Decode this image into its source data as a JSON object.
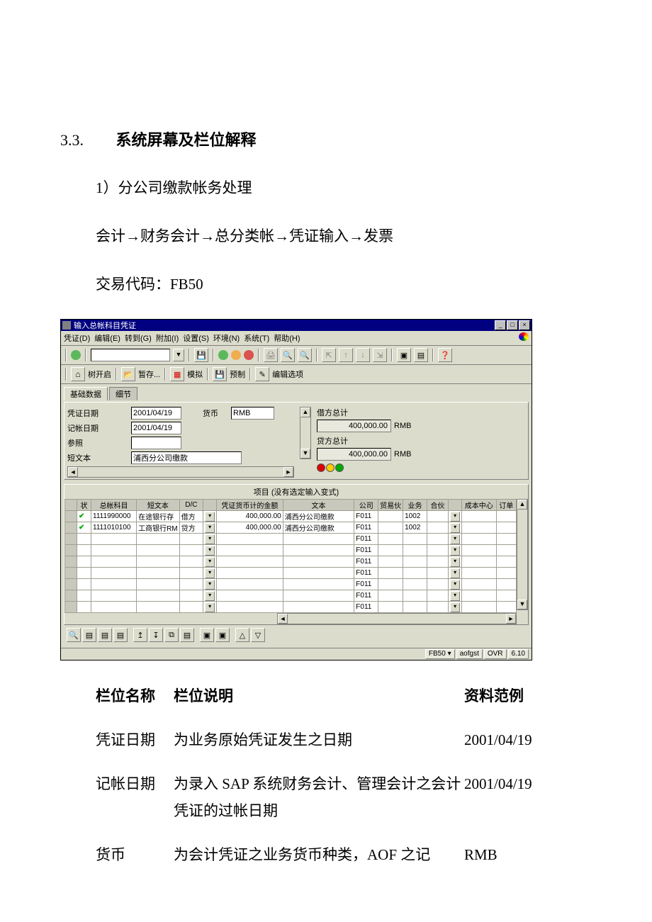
{
  "doc": {
    "section_num": "3.3.",
    "section_title": "系统屏幕及栏位解释",
    "p1": "1）分公司缴款帐务处理",
    "p2": "会计→财务会计→总分类帐→凭证输入→发票",
    "p3": "交易代码：FB50"
  },
  "sap": {
    "titlebar": "输入总帐科目凭证",
    "winbtns": {
      "min": "_",
      "max": "□",
      "close": "×"
    },
    "menu": {
      "m1": "凭证(D)",
      "m2": "编辑(E)",
      "m3": "转到(G)",
      "m4": "附加(I)",
      "m5": "设置(S)",
      "m6": "环境(N)",
      "m7": "系统(T)",
      "m8": "帮助(H)"
    },
    "tb2": {
      "tree": "树开启",
      "park": "暂存...",
      "simulate": "模拟",
      "preset": "预制",
      "editopt": "编辑选项"
    },
    "tabs": {
      "basic": "基础数据",
      "detail": "细节"
    },
    "header": {
      "docdate_label": "凭证日期",
      "docdate": "2001/04/19",
      "currency_label": "货币",
      "currency": "RMB",
      "postdate_label": "记帐日期",
      "postdate": "2001/04/19",
      "ref_label": "参照",
      "shorttxt_label": "短文本",
      "shorttxt": "浦西分公司缴款",
      "debit_label": "借方总计",
      "credit_label": "贷方总计",
      "total_amount": "400,000.00",
      "total_curr": "RMB"
    },
    "items": {
      "title": "项目  (没有选定输入变式)",
      "cols": {
        "status": "状",
        "glacct": "总帐科目",
        "shorttxt": "短文本",
        "dc": "D/C",
        "amount": "凭证货币计的金额",
        "text": "文本",
        "company": "公司",
        "partner1": "贸易伙",
        "ba": "业务",
        "partner2": "合伙",
        "cc": "成本中心",
        "order": "订单"
      },
      "rows": [
        {
          "ok": true,
          "gl": "1111990000",
          "st": "在途银行存",
          "dc": "借方",
          "amt": "400,000.00",
          "txt": "浦西分公司缴款",
          "co": "F011",
          "ba": "1002"
        },
        {
          "ok": true,
          "gl": "1111010100",
          "st": "工商银行RM",
          "dc": "贷方",
          "amt": "400,000.00",
          "txt": "浦西分公司缴款",
          "co": "F011",
          "ba": "1002"
        },
        {
          "co": "F011"
        },
        {
          "co": "F011"
        },
        {
          "co": "F011"
        },
        {
          "co": "F011"
        },
        {
          "co": "F011"
        },
        {
          "co": "F011"
        },
        {
          "co": "F011"
        }
      ]
    },
    "status": {
      "tcode": "FB50",
      "user": "aofgst",
      "mode": "OVR",
      "ver": "6.10"
    }
  },
  "explain": {
    "h1": "栏位名称",
    "h2": "栏位说明",
    "h3": "资料范例",
    "r1": {
      "name": "凭证日期",
      "desc": "为业务原始凭证发生之日期",
      "ex": "2001/04/19"
    },
    "r2": {
      "name": "记帐日期",
      "desc": "为录入 SAP 系统财务会计、管理会计之会计凭证的过帐日期",
      "ex": "2001/04/19"
    },
    "r3": {
      "name": "货币",
      "desc": "为会计凭证之业务货币种类，AOF 之记",
      "ex": "RMB"
    }
  }
}
